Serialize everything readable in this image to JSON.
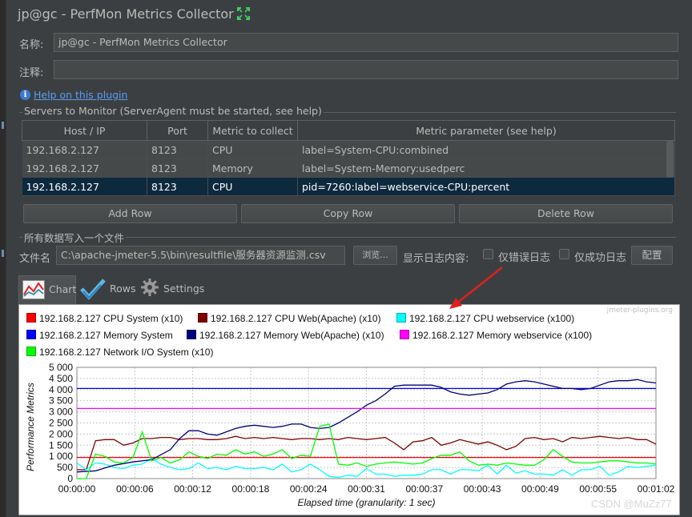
{
  "window": {
    "title": "jp@gc - PerfMon Metrics Collector"
  },
  "form": {
    "name_label": "名称:",
    "name_value": "jp@gc - PerfMon Metrics Collector",
    "comment_label": "注释:",
    "comment_value": ""
  },
  "help": {
    "link": "Help on this plugin"
  },
  "servers": {
    "section_title": "Servers to Monitor (ServerAgent must be started, see help)",
    "columns": [
      "Host / IP",
      "Port",
      "Metric to collect",
      "Metric parameter (see help)"
    ],
    "rows": [
      {
        "host": "192.168.2.127",
        "port": "8123",
        "metric": "CPU",
        "param": "label=System-CPU:combined"
      },
      {
        "host": "192.168.2.127",
        "port": "8123",
        "metric": "Memory",
        "param": "label=System-Memory:usedperc"
      },
      {
        "host": "192.168.2.127",
        "port": "8123",
        "metric": "CPU",
        "param": "pid=7260:label=webservice-CPU:percent"
      }
    ],
    "add_row": "Add Row",
    "copy_row": "Copy Row",
    "delete_row": "Delete Row"
  },
  "file": {
    "section_title": "所有数据写入一个文件",
    "label": "文件名",
    "value": "C:\\apache-jmeter-5.5\\bin\\resultfile\\服务器资源监测.csv",
    "browse": "浏览...",
    "log_content_label": "显示日志内容:",
    "errors_only": "仅错误日志",
    "success_only": "仅成功日志",
    "configure": "配置"
  },
  "tabs": {
    "chart": "Chart",
    "rows": "Rows",
    "settings": "Settings"
  },
  "chart_watermark": "jmeter-plugins.org",
  "chart_data": {
    "type": "line",
    "xlabel": "Elapsed time (granularity: 1 sec)",
    "ylabel": "Performance Metrics",
    "ylim": [
      0,
      5000
    ],
    "yticks": [
      "0",
      "500",
      "1 000",
      "1 500",
      "2 000",
      "2 500",
      "3 000",
      "3 500",
      "4 000",
      "4 500",
      "5 000"
    ],
    "xlim": [
      0,
      62
    ],
    "xticks": [
      "00:00:00",
      "00:00:06",
      "00:00:12",
      "00:00:18",
      "00:00:24",
      "00:00:31",
      "00:00:37",
      "00:00:43",
      "00:00:49",
      "00:00:55",
      "00:01:02"
    ],
    "grid": true,
    "legend_position": "top",
    "series": [
      {
        "name": "192.168.2.127 CPU System (x10)",
        "color": "#ff0000",
        "x": [
          0,
          62
        ],
        "values": [
          950,
          950
        ]
      },
      {
        "name": "192.168.2.127 CPU Web(Apache) (x10)",
        "color": "#800000",
        "x": [
          0,
          1,
          2,
          3,
          4,
          5,
          6,
          7,
          8,
          9,
          10,
          11,
          12,
          13,
          14,
          15,
          16,
          17,
          18,
          19,
          20,
          21,
          22,
          23,
          24,
          25,
          26,
          27,
          28,
          29,
          30,
          31,
          32,
          33,
          34,
          35,
          36,
          37,
          38,
          39,
          40,
          41,
          42,
          43,
          44,
          45,
          46,
          47,
          48,
          49,
          50,
          51,
          52,
          53,
          54,
          55,
          56,
          57,
          58,
          59,
          60,
          61,
          62
        ],
        "values": [
          400,
          400,
          1700,
          1750,
          1750,
          1500,
          1600,
          1800,
          1800,
          1850,
          1850,
          1750,
          1800,
          1800,
          1750,
          1750,
          1800,
          1900,
          1800,
          1850,
          1800,
          1850,
          1800,
          1750,
          1800,
          1800,
          1750,
          1800,
          1750,
          1850,
          1800,
          1750,
          1800,
          1850,
          1600,
          1300,
          1650,
          1700,
          1850,
          1500,
          1600,
          1750,
          1650,
          1550,
          1650,
          1500,
          1300,
          1450,
          1800,
          1850,
          1750,
          1800,
          1650,
          1850,
          1800,
          1850,
          1900,
          1850,
          1800,
          1850,
          1750,
          1750,
          1550
        ]
      },
      {
        "name": "192.168.2.127 CPU webservice (x100)",
        "color": "#00ffff",
        "x": [
          0,
          1,
          2,
          3,
          4,
          5,
          6,
          7,
          8,
          9,
          10,
          11,
          12,
          13,
          14,
          15,
          16,
          17,
          18,
          19,
          20,
          21,
          22,
          23,
          24,
          25,
          26,
          27,
          28,
          29,
          30,
          31,
          32,
          33,
          34,
          35,
          36,
          37,
          38,
          39,
          40,
          41,
          42,
          43,
          44,
          45,
          46,
          47,
          48,
          49,
          50,
          51,
          52,
          53,
          54,
          55,
          56,
          57,
          58,
          59,
          60,
          61,
          62
        ],
        "values": [
          700,
          400,
          700,
          650,
          500,
          450,
          600,
          650,
          900,
          650,
          500,
          400,
          450,
          700,
          450,
          500,
          400,
          550,
          450,
          450,
          500,
          400,
          650,
          300,
          400,
          650,
          400,
          100,
          50,
          150,
          100,
          450,
          200,
          200,
          100,
          150,
          150,
          200,
          400,
          400,
          200,
          400,
          400,
          350,
          600,
          200,
          600,
          250,
          350,
          200,
          200,
          150,
          400,
          150,
          400,
          400,
          550,
          150,
          300,
          550,
          500,
          550,
          600
        ]
      },
      {
        "name": "192.168.2.127 Memory System",
        "color": "#0000ff",
        "x": [
          0,
          62
        ],
        "values": [
          4050,
          4050
        ]
      },
      {
        "name": "192.168.2.127 Memory Web(Apache) (x10)",
        "color": "#000080",
        "x": [
          0,
          2,
          4,
          6,
          8,
          10,
          11,
          12,
          13,
          14,
          15,
          16,
          17,
          18,
          19,
          20,
          21,
          22,
          23,
          24,
          25,
          26,
          27,
          28,
          29,
          30,
          31,
          32,
          33,
          34,
          35,
          36,
          37,
          38,
          39,
          40,
          41,
          42,
          43,
          44,
          45,
          46,
          47,
          48,
          49,
          50,
          51,
          52,
          53,
          54,
          55,
          56,
          57,
          58,
          59,
          60,
          61,
          62
        ],
        "values": [
          300,
          350,
          600,
          750,
          850,
          1300,
          1800,
          2150,
          2150,
          2000,
          1950,
          2100,
          2250,
          2350,
          2400,
          2350,
          2300,
          2350,
          2450,
          2450,
          2300,
          2250,
          2300,
          2500,
          2750,
          3000,
          3300,
          3500,
          3800,
          4150,
          4200,
          4200,
          4200,
          4200,
          4100,
          3900,
          3800,
          3750,
          3800,
          3850,
          4000,
          4250,
          4350,
          4400,
          4350,
          4250,
          4150,
          4050,
          4050,
          4000,
          4050,
          4200,
          4350,
          4400,
          4400,
          4450,
          4350,
          4300
        ]
      },
      {
        "name": "192.168.2.127 Memory webservice (x100)",
        "color": "#ff00ff",
        "x": [
          0,
          62
        ],
        "values": [
          3150,
          3150
        ]
      },
      {
        "name": "192.168.2.127 Network I/O System (x10)",
        "color": "#00ff00",
        "x": [
          0,
          1,
          2,
          3,
          4,
          5,
          6,
          7,
          8,
          9,
          10,
          11,
          12,
          13,
          14,
          15,
          16,
          17,
          18,
          19,
          20,
          21,
          22,
          23,
          24,
          25,
          26,
          27,
          28,
          29,
          30,
          31,
          32,
          33,
          34,
          35,
          36,
          37,
          38,
          39,
          40,
          41,
          42,
          43,
          44,
          45,
          46,
          47,
          48,
          49,
          50,
          51,
          52,
          53,
          54,
          55,
          56,
          57,
          58,
          59,
          60,
          61,
          62
        ],
        "values": [
          0,
          0,
          1100,
          1000,
          750,
          700,
          950,
          2100,
          800,
          950,
          700,
          850,
          1200,
          1000,
          900,
          1100,
          1050,
          1300,
          1100,
          1200,
          1000,
          1100,
          1300,
          900,
          1050,
          1000,
          2350,
          2450,
          650,
          600,
          700,
          550,
          650,
          700,
          750,
          700,
          650,
          700,
          900,
          1050,
          1050,
          1200,
          800,
          600,
          650,
          600,
          700,
          650,
          600,
          600,
          850,
          1300,
          1000,
          750,
          700,
          700,
          750,
          800,
          800,
          750,
          700,
          700,
          650
        ]
      }
    ]
  },
  "footer": {
    "csdn": "CSDN @MuZz77"
  }
}
